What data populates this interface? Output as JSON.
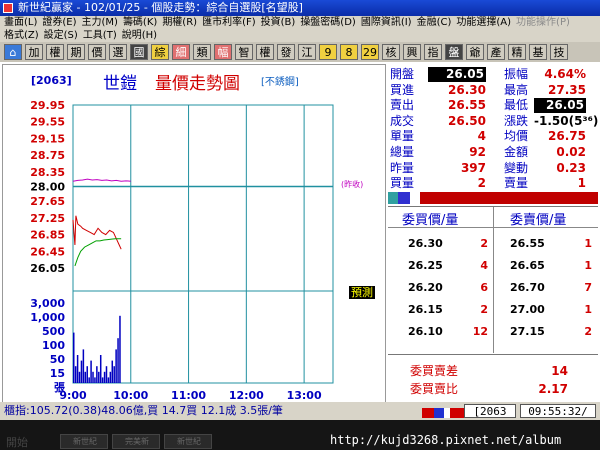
{
  "window": {
    "title": "新世紀贏家 - 102/01/25 - 個股走勢：綜合自選股[名望股]"
  },
  "menu": {
    "row1": [
      {
        "label": "畫面(L)",
        "enabled": true
      },
      {
        "label": "證券(E)",
        "enabled": true
      },
      {
        "label": "主力(M)",
        "enabled": true
      },
      {
        "label": "籌碼(K)",
        "enabled": true
      },
      {
        "label": "期權(R)",
        "enabled": true
      },
      {
        "label": "匯市利率(F)",
        "enabled": true
      },
      {
        "label": "投資(B)",
        "enabled": true
      },
      {
        "label": "操盤密碼(D)",
        "enabled": true
      },
      {
        "label": "國際資訊(I)",
        "enabled": true
      },
      {
        "label": "金融(C)",
        "enabled": true
      },
      {
        "label": "功能選擇(A)",
        "enabled": true
      },
      {
        "label": "功能操作(P)",
        "enabled": false
      }
    ],
    "row2": [
      {
        "label": "格式(Z)",
        "enabled": true
      },
      {
        "label": "設定(S)",
        "enabled": true
      },
      {
        "label": "工具(T)",
        "enabled": true
      },
      {
        "label": "說明(H)",
        "enabled": true
      }
    ]
  },
  "toolbar": {
    "buttons": [
      {
        "label": "⌂",
        "name": "home-button",
        "style": "home"
      },
      {
        "label": "加",
        "name": "add-button",
        "style": ""
      },
      {
        "label": "權",
        "name": "warrant-button",
        "style": ""
      },
      {
        "label": "期",
        "name": "futures-button",
        "style": ""
      },
      {
        "label": "價",
        "name": "price-button",
        "style": ""
      },
      {
        "label": "選",
        "name": "select-button",
        "style": ""
      },
      {
        "label": "國",
        "name": "intl-button",
        "style": "dark"
      },
      {
        "label": "綜",
        "name": "composite-button",
        "style": "hi"
      },
      {
        "label": "細",
        "name": "detail-button",
        "style": "pink"
      },
      {
        "label": "類",
        "name": "category-button",
        "style": ""
      },
      {
        "label": "幅",
        "name": "range-button",
        "style": "pink"
      },
      {
        "label": "智",
        "name": "smart-button",
        "style": ""
      },
      {
        "label": "權",
        "name": "rights-button",
        "style": ""
      },
      {
        "label": "發",
        "name": "issue-button",
        "style": ""
      },
      {
        "label": "江",
        "name": "jiang-button",
        "style": ""
      },
      {
        "label": "9",
        "name": "nine-button",
        "style": "hi"
      },
      {
        "label": "8",
        "name": "eight-button",
        "style": "hi"
      },
      {
        "label": "29",
        "name": "twentynine-button",
        "style": "hi"
      },
      {
        "label": "核",
        "name": "core-button",
        "style": ""
      },
      {
        "label": "興",
        "name": "emerging-button",
        "style": ""
      },
      {
        "label": "指",
        "name": "index-button",
        "style": ""
      },
      {
        "label": "盤",
        "name": "board-button",
        "style": "dark"
      },
      {
        "label": "爺",
        "name": "ye-button",
        "style": ""
      },
      {
        "label": "產",
        "name": "industry-button",
        "style": ""
      },
      {
        "label": "精",
        "name": "elite-button",
        "style": ""
      },
      {
        "label": "基",
        "name": "fund-button",
        "style": ""
      },
      {
        "label": "技",
        "name": "tech-button",
        "style": ""
      }
    ]
  },
  "chart": {
    "code": "[2063]",
    "name": "世鎧",
    "title": "量價走勢圖",
    "subtitle": "[不銹鋼]",
    "prev_close_tag": "(昨收)"
  },
  "chart_data": {
    "type": "line",
    "y_price_ticks": [
      "29.95",
      "29.55",
      "29.15",
      "28.75",
      "28.35",
      "28.00",
      "27.65",
      "27.25",
      "26.85",
      "26.45",
      "26.05"
    ],
    "y_price_values": [
      29.95,
      29.55,
      29.15,
      28.75,
      28.35,
      28.0,
      27.65,
      27.25,
      26.85,
      26.45,
      26.05
    ],
    "y_volume_ticks": [
      "3,000",
      "1,000",
      "500",
      "100",
      "50",
      "15"
    ],
    "volume_unit": "張",
    "x_ticks": [
      "9:00",
      "10:00",
      "11:00",
      "12:00",
      "13:00"
    ],
    "prev_close": 28.0,
    "prev_close_series": {
      "color": "#c000c0",
      "x_min": [
        0,
        5,
        10,
        15,
        20,
        25,
        30,
        35,
        40,
        45,
        50,
        55,
        60
      ],
      "y": [
        28.03,
        28.05,
        28.06,
        28.08,
        28.06,
        28.07,
        28.05,
        28.06,
        28.04,
        28.05,
        28.03,
        28.04,
        28.03
      ]
    },
    "series": [
      {
        "color": "#d00000",
        "x_min": [
          0,
          2,
          3,
          5,
          8,
          10,
          14,
          18,
          22,
          26,
          30,
          34,
          38,
          42,
          46,
          48,
          50
        ],
        "y": [
          27.2,
          26.6,
          27.3,
          27.1,
          27.05,
          27.0,
          26.95,
          26.9,
          26.85,
          27.0,
          26.9,
          26.85,
          26.95,
          26.9,
          26.7,
          26.6,
          26.5
        ]
      },
      {
        "color": "#00a000",
        "x_min": [
          2,
          5,
          8,
          12,
          16,
          20,
          24,
          28,
          32,
          36,
          40,
          44,
          48,
          50
        ],
        "y": [
          26.1,
          26.3,
          26.45,
          26.55,
          26.6,
          26.65,
          26.7,
          26.7,
          26.72,
          26.73,
          26.74,
          26.75,
          26.75,
          26.75
        ]
      }
    ],
    "volume": {
      "color": "#0000c0",
      "x_min": [
        0,
        2,
        4,
        6,
        8,
        10,
        12,
        14,
        16,
        18,
        20,
        22,
        24,
        26,
        28,
        30,
        32,
        34,
        36,
        38,
        40,
        42,
        44,
        46,
        48
      ],
      "values": [
        9,
        3,
        5,
        2,
        4,
        6,
        2,
        3,
        1,
        4,
        2,
        1,
        3,
        2,
        5,
        1,
        2,
        3,
        1,
        2,
        4,
        3,
        6,
        8,
        12
      ]
    },
    "x_range_min": [
      0,
      270
    ]
  },
  "quote": {
    "rows": [
      {
        "l1": "開盤",
        "v1": "26.05",
        "h1": true,
        "c1": "blk",
        "l2": "振幅",
        "v2": "4.64%",
        "c2": "red"
      },
      {
        "l1": "買進",
        "v1": "26.30",
        "h1": false,
        "c1": "red",
        "l2": "最高",
        "v2": "27.35",
        "c2": "red"
      },
      {
        "l1": "賣出",
        "v1": "26.55",
        "h1": false,
        "c1": "red",
        "l2": "最低",
        "v2": "26.05",
        "c2": "hl"
      },
      {
        "l1": "成交",
        "v1": "26.50",
        "h1": false,
        "c1": "red",
        "l2": "漲跌",
        "v2": "-1.50(5³⁶)",
        "c2": "blk"
      },
      {
        "l1": "單量",
        "v1": "4",
        "h1": false,
        "c1": "red",
        "l2": "均價",
        "v2": "26.75",
        "c2": "red"
      },
      {
        "l1": "總量",
        "v1": "92",
        "h1": false,
        "c1": "red",
        "l2": "金額",
        "v2": "0.02",
        "c2": "red"
      },
      {
        "l1": "昨量",
        "v1": "397",
        "h1": false,
        "c1": "red",
        "l2": "變動",
        "v2": "0.23",
        "c2": "red"
      },
      {
        "l1": "買量",
        "v1": "2",
        "h1": false,
        "c1": "red",
        "l2": "賣量",
        "v2": "1",
        "c2": "red"
      }
    ]
  },
  "depth_bar": [
    {
      "color": "#30a0a0",
      "w": 10
    },
    {
      "color": "#3030d0",
      "w": 12
    },
    {
      "color": "#ffffff",
      "w": 10
    },
    {
      "color": "#c00000",
      "w": 178
    }
  ],
  "book": {
    "bid_header": "委買價/量",
    "ask_header": "委賣價/量",
    "rows": [
      {
        "bp": "26.30",
        "bq": "2",
        "ap": "26.55",
        "aq": "1"
      },
      {
        "bp": "26.25",
        "bq": "4",
        "ap": "26.65",
        "aq": "1"
      },
      {
        "bp": "26.20",
        "bq": "6",
        "ap": "26.70",
        "aq": "7"
      },
      {
        "bp": "26.15",
        "bq": "2",
        "ap": "27.00",
        "aq": "1"
      },
      {
        "bp": "26.10",
        "bq": "12",
        "ap": "27.15",
        "aq": "2"
      }
    ]
  },
  "summary": {
    "diff_label": "委買賣差",
    "diff_value": "14",
    "ratio_label": "委買賣比",
    "ratio_value": "2.17"
  },
  "predict_label": "預測",
  "status": {
    "index_text": "櫃指:105.72(0.38)48.06億,買 14.7買 12.1成 3.5張/筆",
    "code": "[2063",
    "time": "09:55:32/"
  },
  "taskbar": {
    "watermark": "http://kujd3268.pixnet.net/album",
    "start_label": "開始",
    "tasks": [
      "新世紀",
      "完美新",
      "新世紀"
    ]
  },
  "colors": {
    "up": "#d00000",
    "down": "#00a000",
    "label": "#0000c0",
    "prev_close": "#c000c0",
    "grid": "#2090a0"
  }
}
